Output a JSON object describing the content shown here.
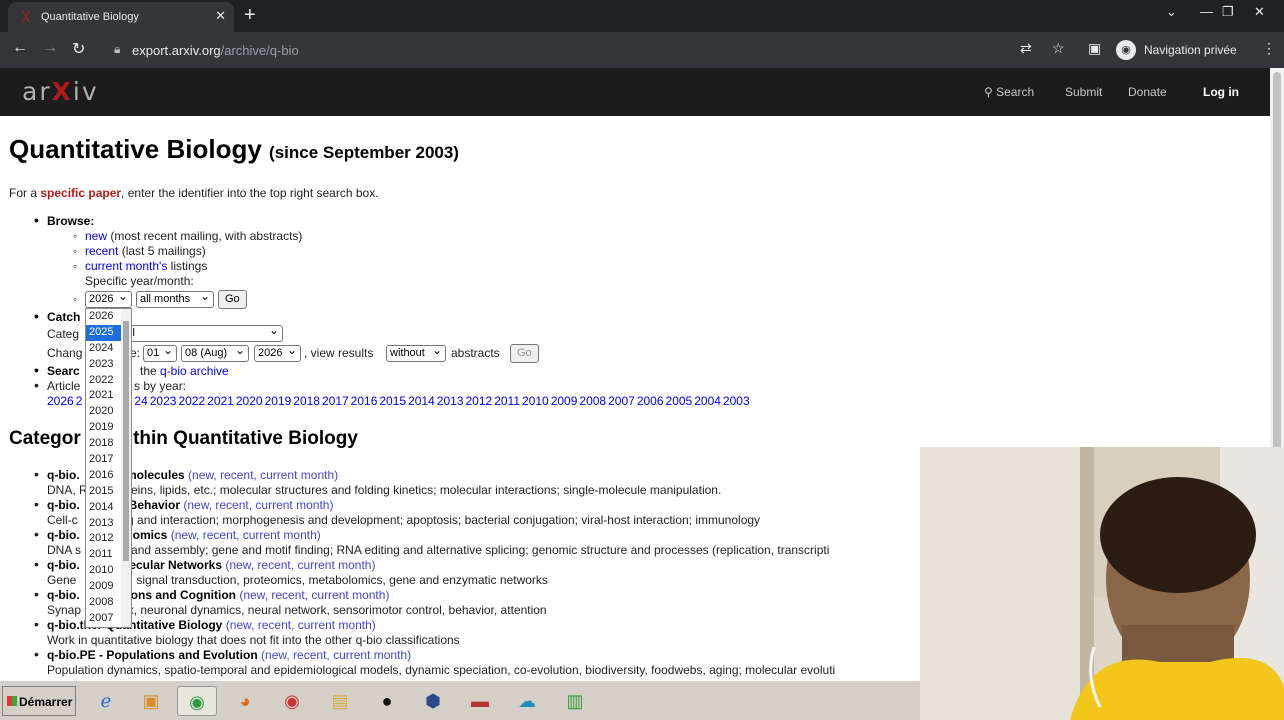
{
  "browser": {
    "tab_title": "Quantitative Biology",
    "url_host": "export.arxiv.org",
    "url_path": "/archive/q-bio",
    "profile_label": "Navigation privée"
  },
  "arxiv_header": {
    "logo_left": "ar",
    "logo_x": "X",
    "logo_right": "iv",
    "search": "Search",
    "submit": "Submit",
    "donate": "Donate",
    "login": "Log in"
  },
  "page": {
    "title": "Quantitative Biology",
    "since": "(since September 2003)",
    "intro_pre": "For a ",
    "intro_link": "specific paper",
    "intro_post": ", enter the identifier into the top right search box.",
    "browse_label": "Browse:",
    "new_link": "new",
    "new_desc": " (most recent mailing, with abstracts)",
    "recent_link": "recent",
    "recent_desc": " (last 5 mailings)",
    "current_link": "current month's",
    "current_desc": " listings",
    "specific_label": "Specific year/month:",
    "year_value": "2026",
    "month_value": "all months",
    "go": "Go",
    "catchup_label": "Catch",
    "category_label": "Categ",
    "category_value": "ll",
    "changes_label": "Chang",
    "changes_mid": "e:",
    "day_value": "01",
    "month2_value": "08 (Aug)",
    "year2_value": "2026",
    "view_results": ", view results",
    "abstracts_value": "without",
    "abstracts_label": "abstracts",
    "go2": "Go",
    "search_label": "Searc",
    "search_link_pre": "the ",
    "search_link": "q-bio archive",
    "article_label": "Article",
    "article_post": "s by year:",
    "years": [
      "2026",
      "2",
      "24",
      "2023",
      "2022",
      "2021",
      "2020",
      "2019",
      "2018",
      "2017",
      "2016",
      "2015",
      "2014",
      "2013",
      "2012",
      "2011",
      "2010",
      "2009",
      "2008",
      "2007",
      "2006",
      "2005",
      "2004",
      "2003"
    ],
    "categories_heading": "Categor",
    "categories_heading_rest": "ithin Quantitative Biology",
    "categories": [
      {
        "code": "q-bio.",
        "name": "omolecules",
        "new": "new",
        "recent": "recent",
        "current": "current month",
        "desc_a": "DNA, R",
        "desc_b": "teins, lipids, etc.; molecular structures and folding kinetics; molecular interactions; single-molecule manipulation."
      },
      {
        "code": "q-bio.",
        "name": "ll Behavior",
        "new": "new",
        "recent": "recent",
        "current": "current month",
        "desc_a": "Cell-c",
        "desc_b": "ing and interaction; morphogenesis and development; apoptosis; bacterial conjugation; viral-host interaction; immunology"
      },
      {
        "code": "q-bio.",
        "name": "enomics",
        "new": "new",
        "recent": "recent",
        "current": "current month",
        "desc_a": "DNA s",
        "desc_b": "g and assembly; gene and motif finding; RNA editing and alternative splicing; genomic structure and processes (replication, transcripti"
      },
      {
        "code": "q-bio.",
        "name": "olecular Networks",
        "new": "new",
        "recent": "recent",
        "current": "current month",
        "desc_a": "Gene",
        "desc_b": "on, signal transduction, proteomics, metabolomics, gene and enzymatic networks"
      },
      {
        "code": "q-bio.",
        "name": "urons and Cognition",
        "new": "new",
        "recent": "recent",
        "current": "current month",
        "desc_a": "Synap",
        "desc_b": "ex, neuronal dynamics, neural network, sensorimotor control, behavior, attention"
      },
      {
        "code": "q-bio.",
        "name": "ther Quantitative Biology",
        "new": "new",
        "recent": "recent",
        "current": "current month",
        "desc_a": "Work in quantitative biology that does not fit into the other q-bio classifications",
        "desc_b": ""
      },
      {
        "code": "q-bio.PE",
        "name": " - Populations and Evolution",
        "new": "new",
        "recent": "recent",
        "current": "current month",
        "desc_a": "Population dynamics, spatio-temporal and epidemiological models, dynamic speciation, co-evolution, biodiversity, foodwebs, aging; molecular evoluti",
        "desc_b": ""
      }
    ]
  },
  "year_dropdown": {
    "options": [
      "2026",
      "2025",
      "2024",
      "2023",
      "2022",
      "2021",
      "2020",
      "2019",
      "2018",
      "2017",
      "2016",
      "2015",
      "2014",
      "2013",
      "2012",
      "2011",
      "2010",
      "2009",
      "2008",
      "2007"
    ],
    "highlighted": "2025"
  },
  "taskbar": {
    "start_label": "Démarrer"
  },
  "colors": {
    "arxiv_red": "#b31b1b",
    "link_blue": "#0000ee",
    "highlight": "#1e6fd9"
  }
}
